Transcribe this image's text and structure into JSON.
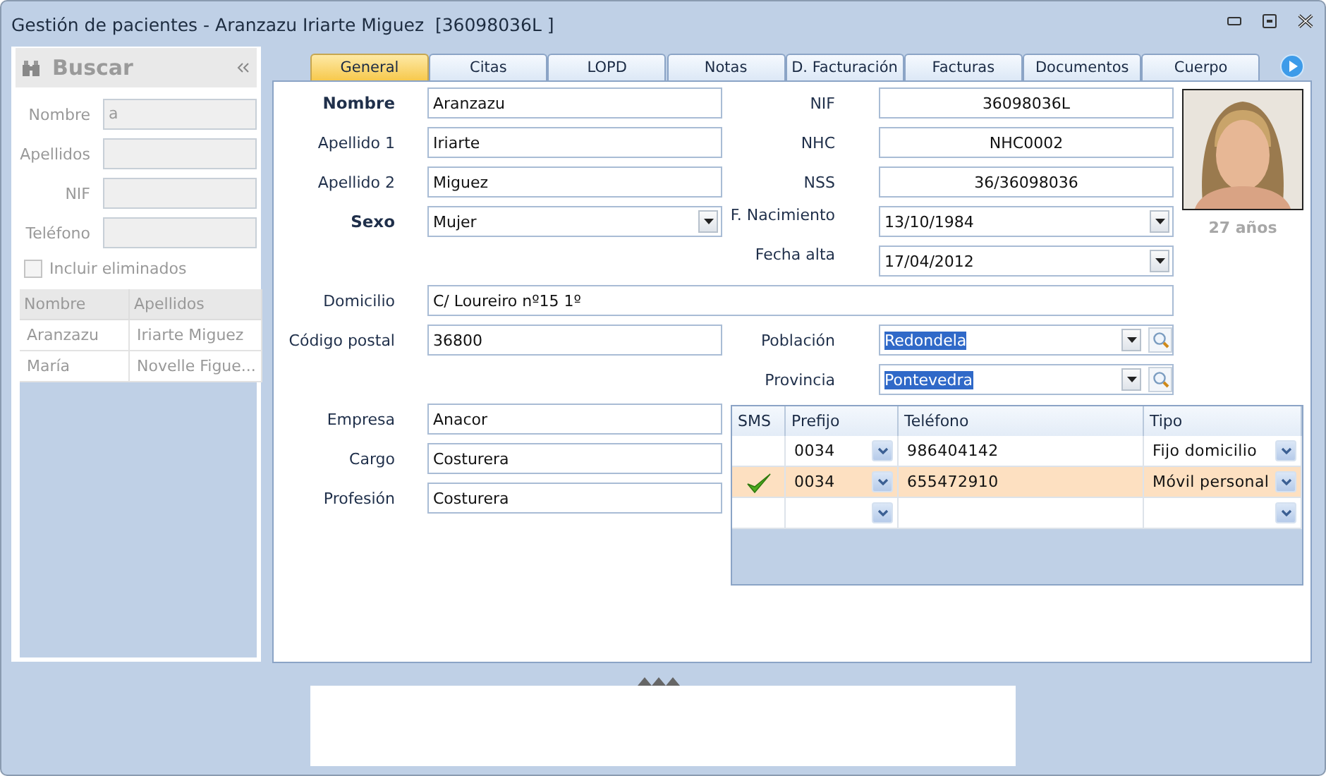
{
  "window": {
    "title": "Gestión de pacientes - Aranzazu Iriarte Miguez  [36098036L ]"
  },
  "search_panel": {
    "title": "Buscar",
    "fields": [
      {
        "label": "Nombre",
        "value": "a"
      },
      {
        "label": "Apellidos"
      },
      {
        "label": "NIF"
      },
      {
        "label": "Teléfono"
      }
    ],
    "include_deleted": {
      "label": "Incluir eliminados",
      "checked": false
    },
    "results": {
      "columns": [
        "Nombre",
        "Apellidos"
      ],
      "rows": [
        {
          "cells": [
            "Aranzazu",
            "Iriarte Miguez"
          ]
        },
        {
          "cells": [
            "María",
            "Novelle Figue..."
          ]
        }
      ]
    }
  },
  "tabs": [
    {
      "label": "General",
      "selected": true
    },
    {
      "label": "Citas",
      "selected": false
    },
    {
      "label": "LOPD",
      "selected": false
    },
    {
      "label": "Notas",
      "selected": false
    },
    {
      "label": "D. Facturación",
      "selected": false
    },
    {
      "label": "Facturas",
      "selected": false
    },
    {
      "label": "Documentos",
      "selected": false
    },
    {
      "label": "Cuerpo",
      "selected": false
    }
  ],
  "form": {
    "identity": [
      {
        "label": "Nombre",
        "value": "Aranzazu",
        "emphasized": true
      },
      {
        "label": "Apellido 1",
        "value": "Iriarte",
        "emphasized": false
      },
      {
        "label": "Apellido 2",
        "value": "Miguez",
        "emphasized": false
      }
    ],
    "codes": [
      {
        "label": "NIF",
        "value": "36098036L"
      },
      {
        "label": "NHC",
        "value": "NHC0002"
      },
      {
        "label": "NSS",
        "value": "36/36098036"
      }
    ],
    "sexo": {
      "label": "Sexo",
      "value": "Mujer",
      "emphasized": true
    },
    "dates": [
      {
        "label": "F. Nacimiento",
        "value": "13/10/1984"
      },
      {
        "label": "Fecha alta",
        "value": "17/04/2012"
      }
    ],
    "age": "27 años",
    "domicilio": {
      "label": "Domicilio",
      "value": "C/ Loureiro nº15 1º"
    },
    "codigo_postal": {
      "label": "Código postal",
      "value": "36800"
    },
    "location": [
      {
        "label": "Población",
        "value": "Redondela",
        "text_selected": true
      },
      {
        "label": "Provincia",
        "value": "Pontevedra",
        "text_selected": true
      }
    ],
    "work": [
      {
        "label": "Empresa",
        "value": "Anacor"
      },
      {
        "label": "Cargo",
        "value": "Costurera"
      },
      {
        "label": "Profesión",
        "value": "Costurera"
      }
    ],
    "phones": {
      "columns": [
        "SMS",
        "Prefijo",
        "Teléfono",
        "Tipo"
      ],
      "rows": [
        {
          "sms": false,
          "prefijo": "0034",
          "telefono": "986404142",
          "tipo": "Fijo domicilio",
          "selected": false
        },
        {
          "sms": true,
          "prefijo": "0034",
          "telefono": "655472910",
          "tipo": "Móvil personal",
          "selected": true
        },
        {
          "sms": false,
          "selected": false
        }
      ]
    }
  }
}
